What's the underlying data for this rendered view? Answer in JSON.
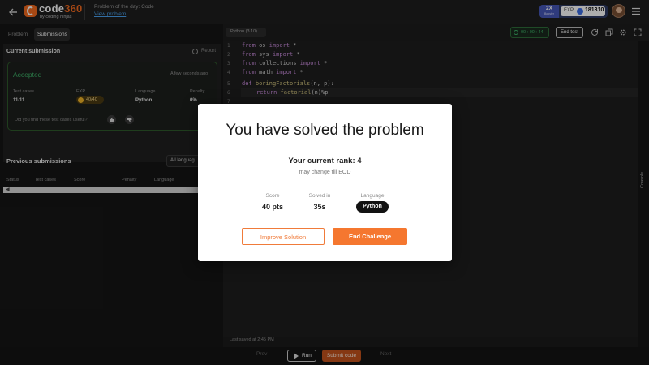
{
  "header": {
    "logo_text": "code",
    "logo_number": "360",
    "logo_sub": "by coding ninjas",
    "potd_label": "Problem of the day: Code",
    "view_problem": "View problem",
    "booster_mult": "2X",
    "booster_word": "Booster",
    "exp_label": "EXP",
    "exp_value": "181310",
    "icons": [
      "back-arrow-icon",
      "hamburger-menu-icon"
    ]
  },
  "left": {
    "tab_problem": "Problem",
    "tab_submissions": "Submissions",
    "current_submission": "Current submission",
    "report": "Report",
    "status": "Accepted",
    "time_ago": "A few seconds ago",
    "col_test_cases": "Test cases",
    "col_exp": "EXP",
    "col_language": "Language",
    "col_penalty": "Penalty",
    "val_test_cases": "11/11",
    "val_exp": "40/40",
    "val_language": "Python",
    "val_penalty": "0%",
    "useful_q": "Did you find these test cases useful?",
    "previous_submissions": "Previous submissions",
    "language_filter": "All languag",
    "tbl_status": "Status",
    "tbl_test_cases": "Test cases",
    "tbl_score": "Score",
    "tbl_penalty": "Penalty",
    "tbl_language": "Language"
  },
  "editor": {
    "language_select": "Python (3.10)",
    "timer": "00 : 00 : 44",
    "end_test": "End test",
    "line_numbers": [
      "1",
      "2",
      "3",
      "4",
      "5",
      "6",
      "7"
    ],
    "lines": [
      {
        "kw1": "from",
        "mod": " os ",
        "kw2": "import",
        "rest": " *"
      },
      {
        "kw1": "from",
        "mod": " sys ",
        "kw2": "import",
        "rest": " *"
      },
      {
        "kw1": "from",
        "mod": " collections ",
        "kw2": "import",
        "rest": " *"
      },
      {
        "kw1": "from",
        "mod": " math ",
        "kw2": "import",
        "rest": " *"
      }
    ],
    "def_kw": "def",
    "def_name": " boringFactorials",
    "def_args": "(n, p):",
    "return_kw": "return",
    "return_fn": " factorial",
    "return_rest": "(n)%p",
    "last_saved": "Last saved at 2:45 PM",
    "console": "Console"
  },
  "bottom": {
    "prev": "Prev",
    "run": "Run",
    "submit": "Submit code",
    "next": "Next"
  },
  "modal": {
    "title": "You have solved the problem",
    "rank": "Your current rank: 4",
    "rank_note": "may change till EOD",
    "score_label": "Score",
    "score_value": "40 pts",
    "solved_label": "Solved in",
    "solved_value": "35s",
    "lang_label": "Language",
    "lang_value": "Python",
    "improve": "Improve Solution",
    "end_challenge": "End Challenge"
  },
  "colors": {
    "accent": "#f5772f",
    "accepted": "#3fb46a",
    "link": "#4aa3f0"
  }
}
